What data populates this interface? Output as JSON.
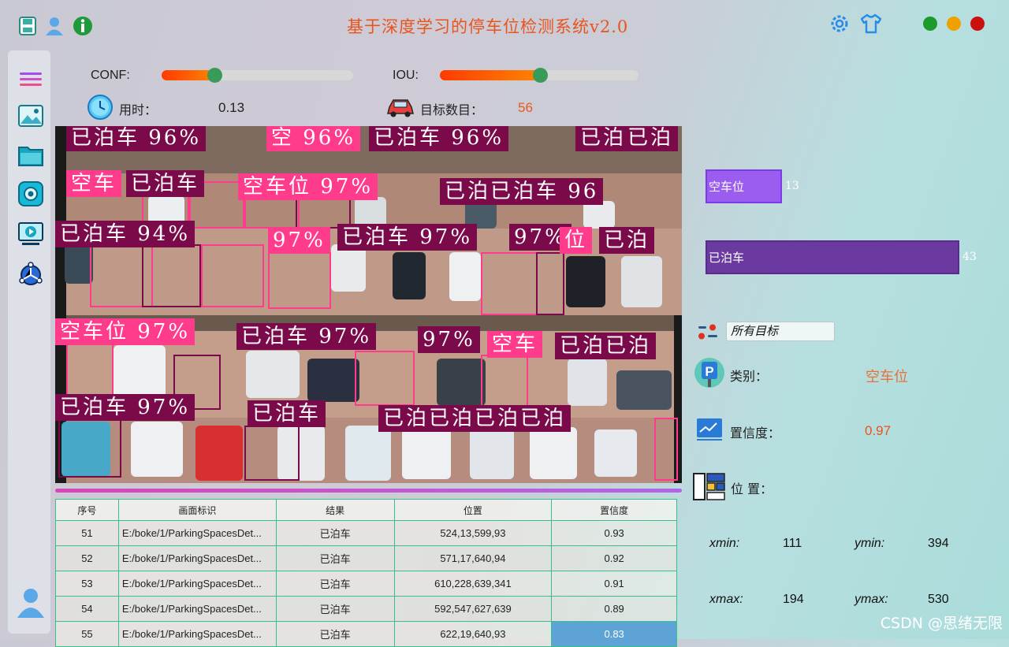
{
  "title": "基于深度学习的停车位检测系统v2.0",
  "titlebar": {
    "left_icons": [
      "save-icon",
      "user-icon",
      "info-icon"
    ],
    "right_icons": [
      "gear-icon",
      "shirt-icon"
    ],
    "window_buttons": [
      {
        "name": "maximize",
        "color": "#1c9a2c"
      },
      {
        "name": "minimize",
        "color": "#f0a000"
      },
      {
        "name": "close",
        "color": "#cc1010"
      }
    ]
  },
  "sidebar": {
    "items": [
      "menu-icon",
      "image-icon",
      "folder-icon",
      "camera-icon",
      "video-icon",
      "model-icon"
    ],
    "bottom": "user-avatar-icon"
  },
  "controls": {
    "conf_label": "CONF:",
    "conf_value": 0.27,
    "iou_label": "IOU:",
    "iou_value": 0.5,
    "time_label": "用时：",
    "time_value": "0.13",
    "count_label": "目标数目：",
    "count_value": "56"
  },
  "detections": [
    "已泊车 96%",
    "空 96%",
    "已泊车 96%",
    "已泊车",
    "已泊",
    "空车",
    "已泊车",
    "空车位 97%",
    "已泊已泊车 96",
    "已泊车 94%",
    "97%",
    "已泊车 97%",
    "97%",
    "位",
    "已泊",
    "空车位 97%",
    "已泊车 97%",
    "97%",
    "空车",
    "已泊已泊",
    "已泊车 97%",
    "已泊车",
    "已泊已泊已泊已泊"
  ],
  "table": {
    "headers": [
      "序号",
      "画面标识",
      "结果",
      "位置",
      "置信度"
    ],
    "rows": [
      [
        "51",
        "E:/boke/1/ParkingSpacesDet...",
        "已泊车",
        "524,13,599,93",
        "0.93"
      ],
      [
        "52",
        "E:/boke/1/ParkingSpacesDet...",
        "已泊车",
        "571,17,640,94",
        "0.92"
      ],
      [
        "53",
        "E:/boke/1/ParkingSpacesDet...",
        "已泊车",
        "610,228,639,341",
        "0.91"
      ],
      [
        "54",
        "E:/boke/1/ParkingSpacesDet...",
        "已泊车",
        "592,547,627,639",
        "0.89"
      ],
      [
        "55",
        "E:/boke/1/ParkingSpacesDet...",
        "已泊车",
        "622,19,640,93",
        "0.83"
      ]
    ]
  },
  "stats": {
    "bars": [
      {
        "label": "空车位",
        "value": 13,
        "color": "#9b5cf0",
        "border": "#7b3ce8"
      },
      {
        "label": "已泊车",
        "value": 43,
        "color": "#6a3aa0",
        "border": "#5a2a8c"
      }
    ],
    "max": 43
  },
  "target_select": {
    "value": "所有目标"
  },
  "result": {
    "class_label": "类别：",
    "class_value": "空车位",
    "conf_label": "置信度：",
    "conf_value": "0.97",
    "pos_label": "位 置：",
    "xmin_label": "xmin:",
    "xmin": "111",
    "ymin_label": "ymin:",
    "ymin": "394",
    "xmax_label": "xmax:",
    "xmax": "194",
    "ymax_label": "ymax:",
    "ymax": "530"
  },
  "watermark": "CSDN @思绪无限"
}
